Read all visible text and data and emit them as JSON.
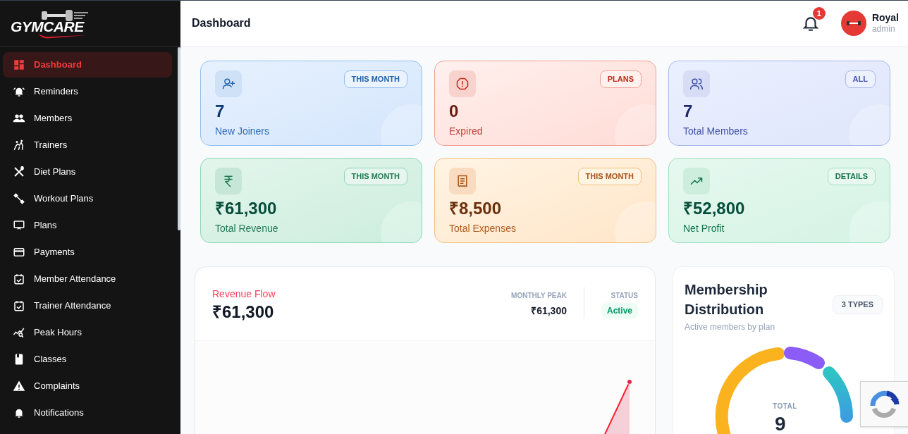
{
  "brand": {
    "name": "GYMCARE"
  },
  "sidebar": {
    "items": [
      {
        "label": "Dashboard",
        "selected": true
      },
      {
        "label": "Reminders",
        "selected": false
      },
      {
        "label": "Members",
        "selected": false
      },
      {
        "label": "Trainers",
        "selected": false
      },
      {
        "label": "Diet Plans",
        "selected": false
      },
      {
        "label": "Workout Plans",
        "selected": false
      },
      {
        "label": "Plans",
        "selected": false
      },
      {
        "label": "Payments",
        "selected": false
      },
      {
        "label": "Member Attendance",
        "selected": false
      },
      {
        "label": "Trainer Attendance",
        "selected": false
      },
      {
        "label": "Peak Hours",
        "selected": false
      },
      {
        "label": "Classes",
        "selected": false
      },
      {
        "label": "Complaints",
        "selected": false
      },
      {
        "label": "Notifications",
        "selected": false
      }
    ]
  },
  "header": {
    "title": "Dashboard",
    "notification_count": "1",
    "user": {
      "name": "Royal",
      "role": "admin"
    }
  },
  "stat_cards": [
    {
      "kind": "joiners",
      "value": "7",
      "label": "New Joiners",
      "tag": "THIS MONTH"
    },
    {
      "kind": "expired",
      "value": "0",
      "label": "Expired",
      "tag": "PLANS"
    },
    {
      "kind": "members",
      "value": "7",
      "label": "Total Members",
      "tag": "ALL"
    },
    {
      "kind": "revenue",
      "value": "₹61,300",
      "label": "Total Revenue",
      "tag": "THIS MONTH"
    },
    {
      "kind": "expenses",
      "value": "₹8,500",
      "label": "Total Expenses",
      "tag": "THIS MONTH"
    },
    {
      "kind": "profit",
      "value": "₹52,800",
      "label": "Net Profit",
      "tag": "DETAILS"
    }
  ],
  "revenue_flow": {
    "title": "Revenue Flow",
    "amount": "₹61,300",
    "peak_label": "MONTHLY PEAK",
    "peak_value": "₹61,300",
    "status_label": "STATUS",
    "status": "Active"
  },
  "membership_distribution": {
    "title": "Membership Distribution",
    "subtitle": "Active members by plan",
    "badge": "3 TYPES",
    "total_label": "TOTAL",
    "total": "9"
  }
}
